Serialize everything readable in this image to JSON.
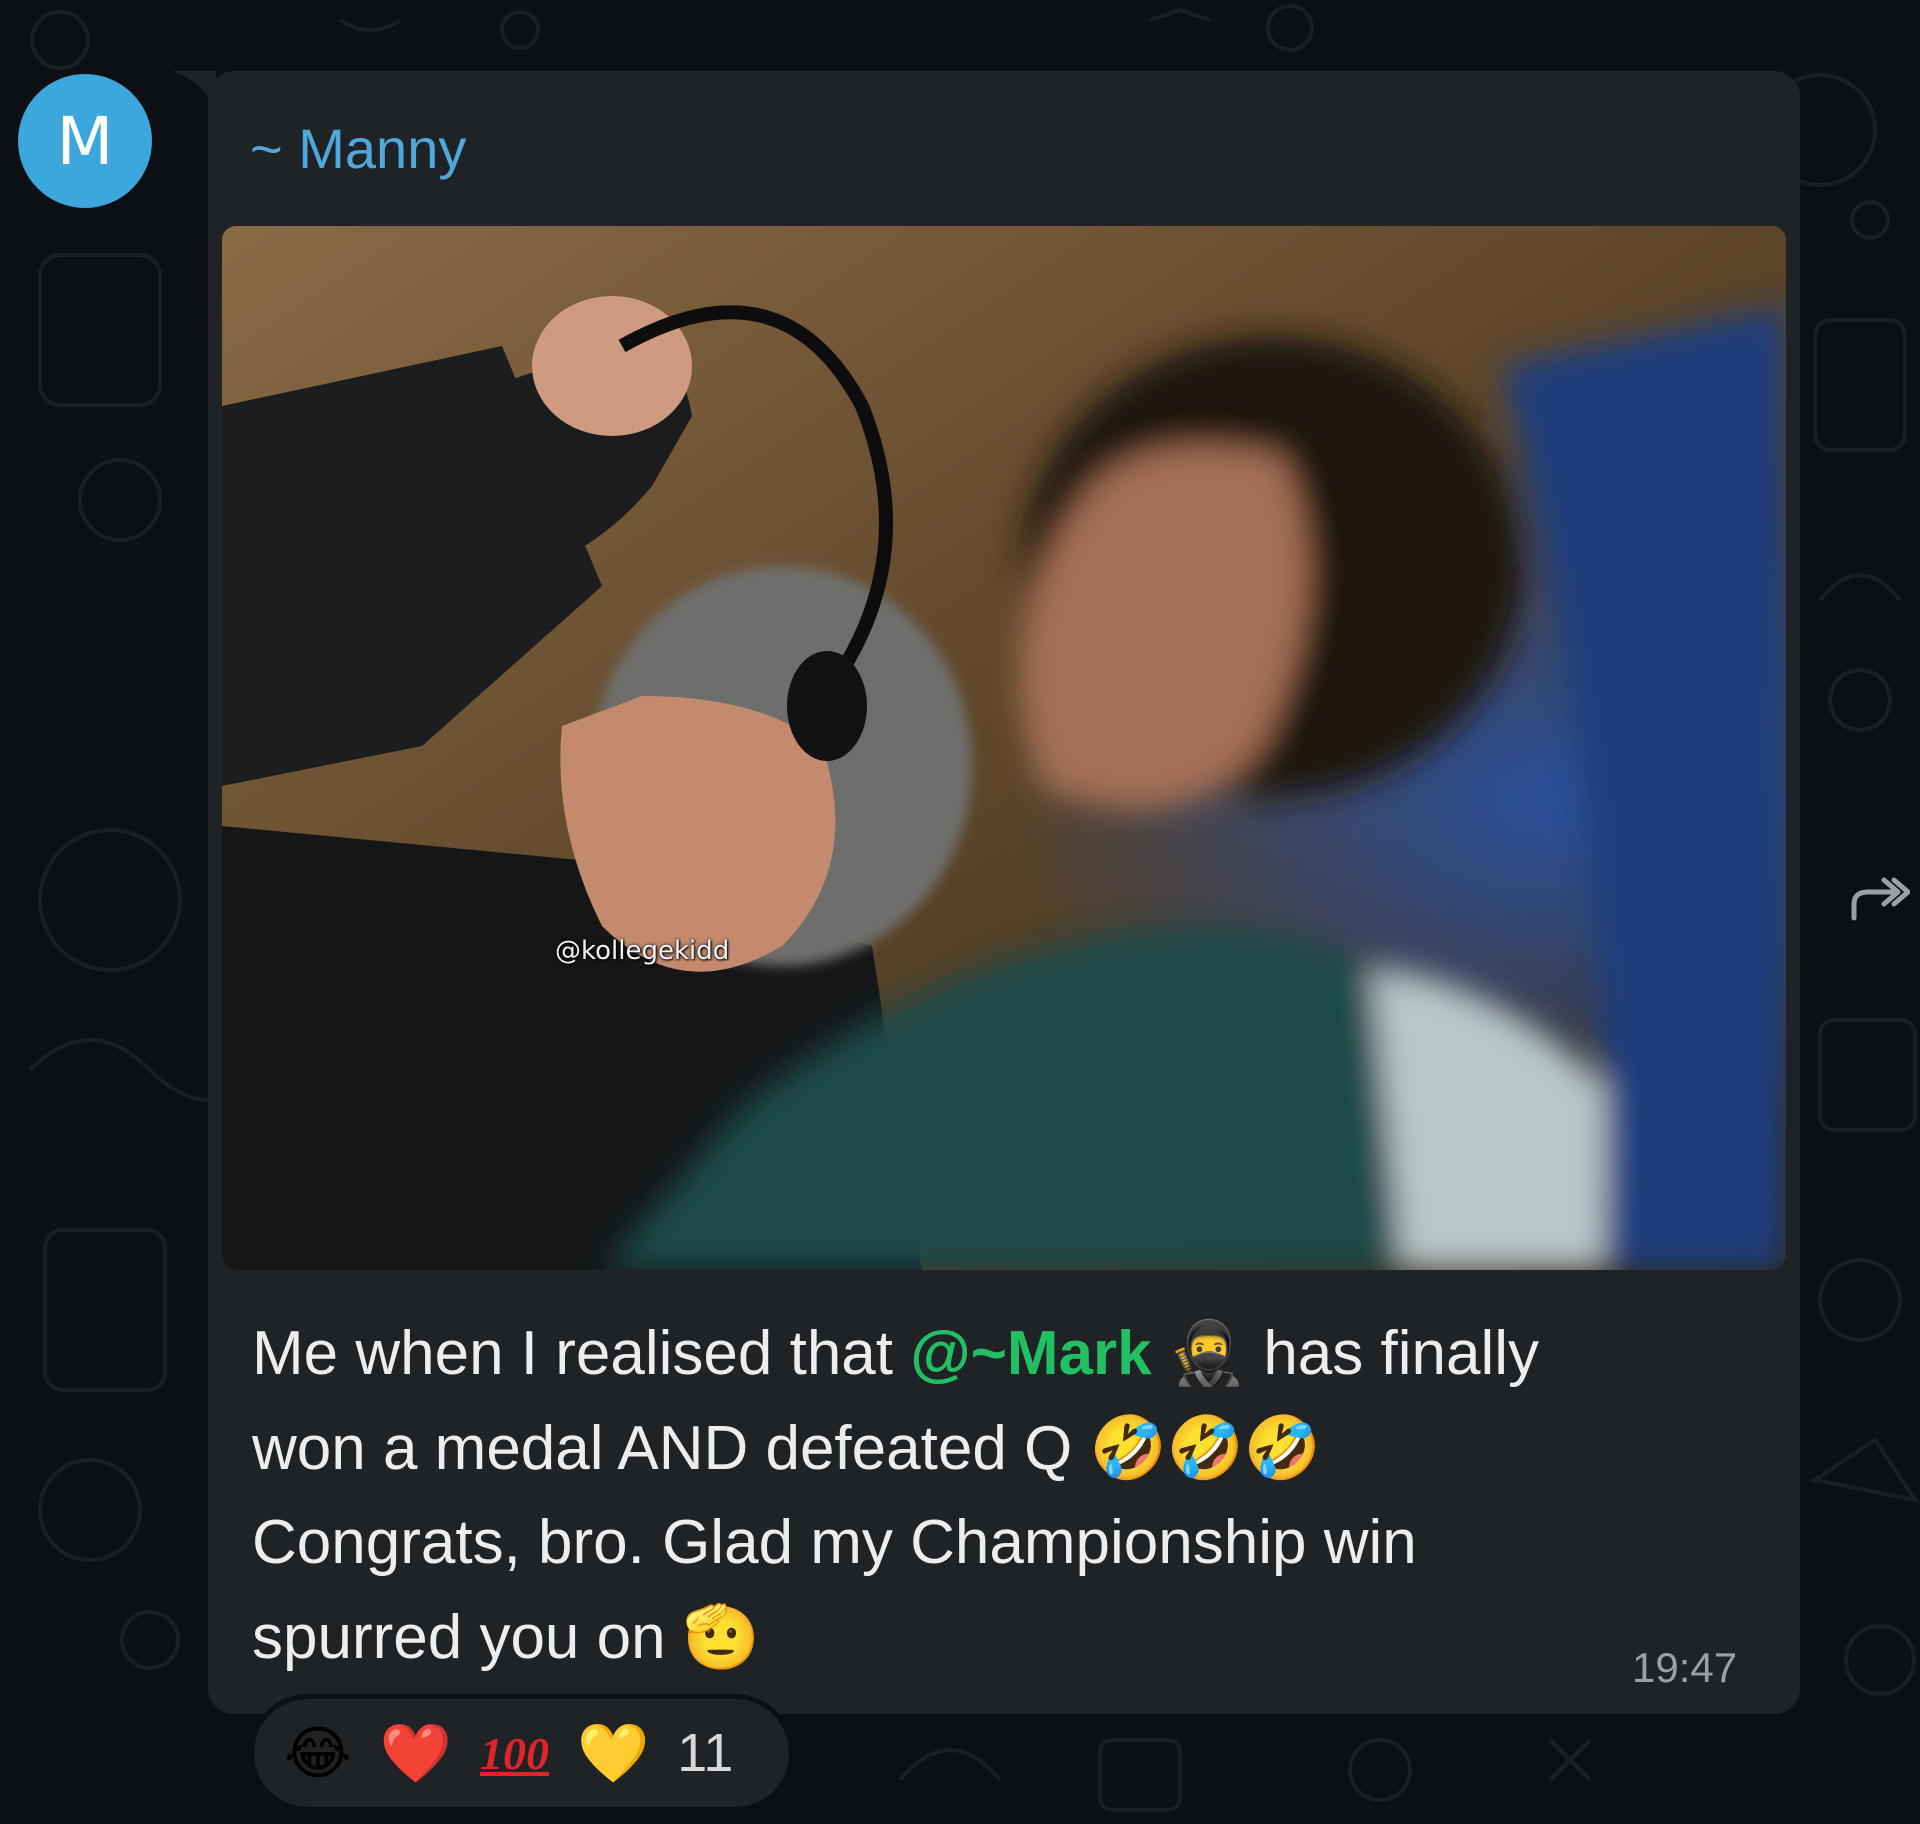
{
  "avatar": {
    "initial": "M",
    "color": "#3ca7dc"
  },
  "message": {
    "sender": "~ Manny",
    "sender_color": "#4fa8dc",
    "image_watermark": "@kollegekidd",
    "caption": {
      "line1_before": "Me when I realised that",
      "mention": "@~Mark",
      "ninja_emoji": "🥷",
      "line1_after": "has finally",
      "line2": "won a medal AND defeated Q",
      "laugh_emojis": "🤣🤣🤣",
      "line3": "Congrats, bro. Glad my Championship win",
      "line4": "spurred you on",
      "salute_emoji": "🫡"
    },
    "mention_color": "#21c063",
    "time": "19:47"
  },
  "reactions": {
    "emojis": [
      "😂",
      "❤️",
      "💯",
      "💛"
    ],
    "hundred_text": "100",
    "count": "11"
  },
  "icons": {
    "forward": "forward-arrow-icon",
    "wallpaper": "doodle-pattern"
  }
}
